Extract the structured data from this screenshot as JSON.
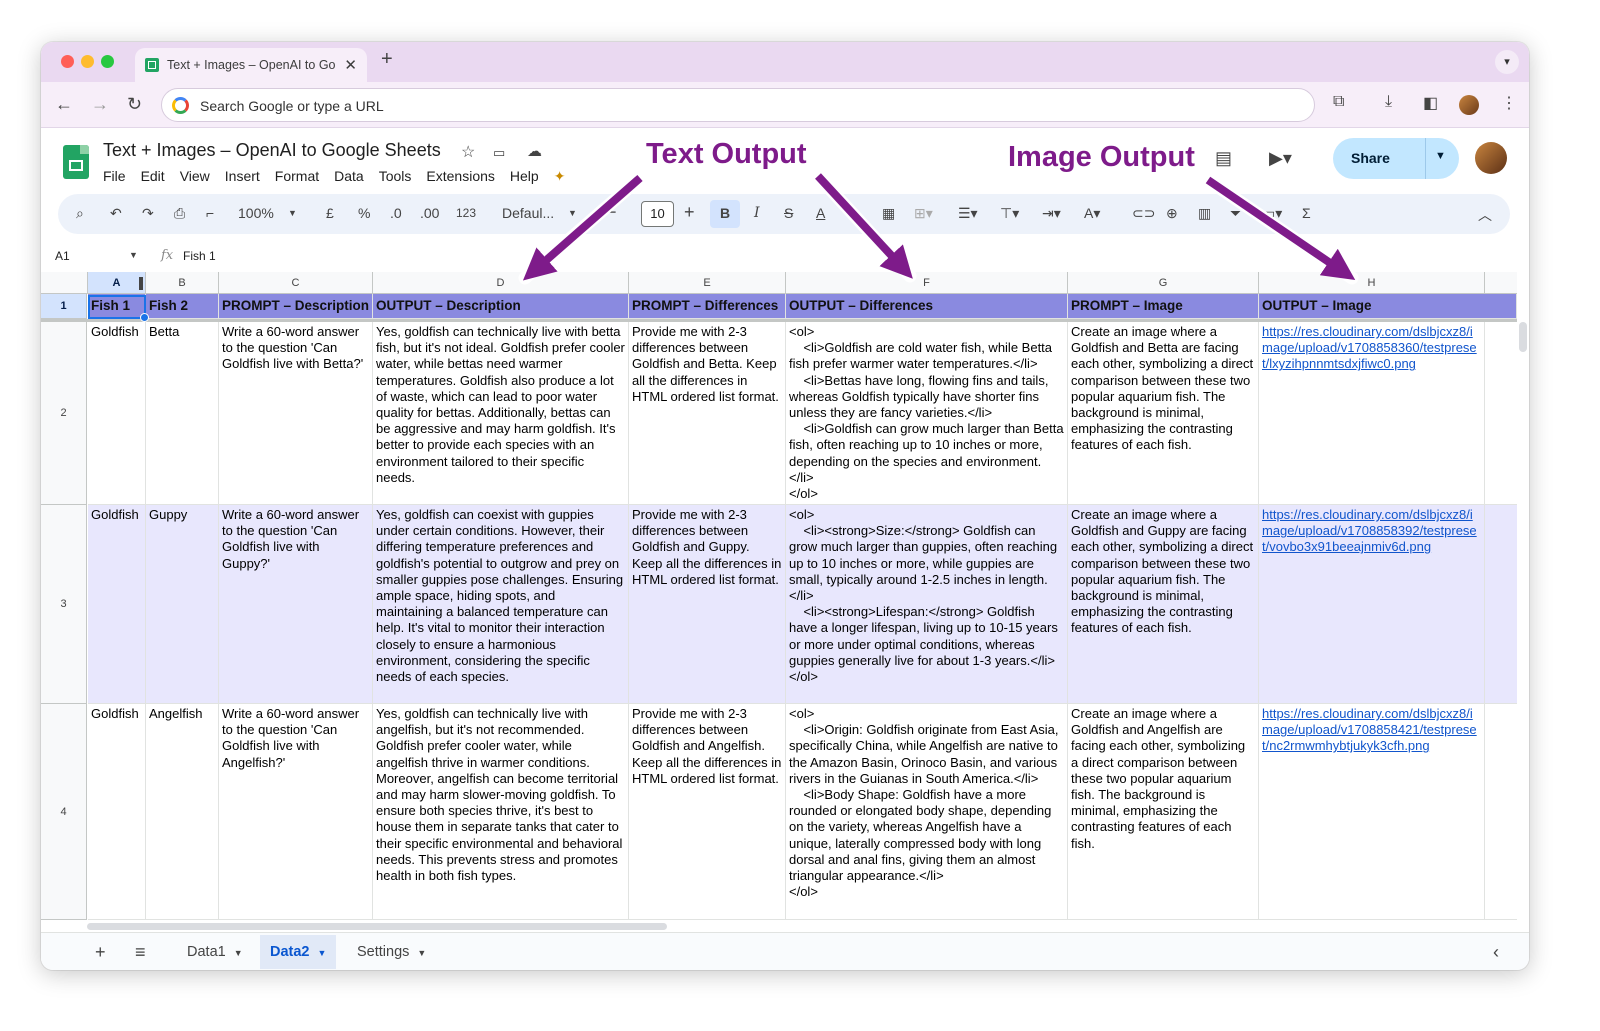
{
  "browser": {
    "tab_title": "Text + Images – OpenAI to Go",
    "omnibox_placeholder": "Search Google or type a URL"
  },
  "doc": {
    "title": "Text + Images – OpenAI to Google Sheets",
    "menu": [
      "File",
      "Edit",
      "View",
      "Insert",
      "Format",
      "Data",
      "Tools",
      "Extensions",
      "Help"
    ],
    "share_label": "Share"
  },
  "toolbar": {
    "zoom": "100%",
    "currency": "£",
    "percent": "%",
    "dec_decrease": ".0",
    "dec_increase": ".00",
    "number_format": "123",
    "font": "Defaul...",
    "font_size": "10",
    "bold": "B",
    "italic": "I",
    "sum": "Σ"
  },
  "formula_bar": {
    "cell_ref": "A1",
    "fx": "fx",
    "value": "Fish 1"
  },
  "annotations": {
    "text_output": "Text Output",
    "image_output": "Image Output"
  },
  "grid": {
    "columns": [
      "A",
      "B",
      "C",
      "D",
      "E",
      "F",
      "G",
      "H"
    ],
    "row_numbers": [
      "1",
      "2",
      "3",
      "4"
    ],
    "header": [
      "Fish 1",
      "Fish 2",
      "PROMPT – Description",
      "OUTPUT – Description",
      "PROMPT – Differences",
      "OUTPUT – Differences",
      "PROMPT – Image",
      "OUTPUT – Image"
    ],
    "rows": [
      [
        "Goldfish",
        "Betta",
        "Write a 60-word answer to the question 'Can Goldfish live with Betta?'",
        "Yes, goldfish can technically live with betta fish, but it's not ideal. Goldfish prefer cooler water, while bettas need warmer temperatures. Goldfish also produce a lot of waste, which can lead to poor water quality for bettas. Additionally, bettas can be aggressive and may harm goldfish. It's better to provide each species with an environment tailored to their specific needs.",
        "Provide me with 2-3 differences between Goldfish and Betta. Keep all the differences in HTML ordered list format.",
        "<ol>\n    <li>Goldfish are cold water fish, while Betta fish prefer warmer water temperatures.</li>\n    <li>Bettas have long, flowing fins and tails, whereas Goldfish typically have shorter fins unless they are fancy varieties.</li>\n    <li>Goldfish can grow much larger than Betta fish, often reaching up to 10 inches or more, depending on the species and environment.</li>\n</ol>",
        "Create an image where a Goldfish and Betta are facing each other, symbolizing a direct comparison between these two popular aquarium fish. The background is minimal, emphasizing the contrasting features of each fish.",
        "https://res.cloudinary.com/dslbjcxz8/image/upload/v1708858360/testpreset/lxyzihpnnmtsdxjfiwc0.png"
      ],
      [
        "Goldfish",
        "Guppy",
        "Write a 60-word answer to the question 'Can Goldfish live with Guppy?'",
        "Yes, goldfish can coexist with guppies under certain conditions. However, their differing temperature preferences and goldfish's potential to outgrow and prey on smaller guppies pose challenges. Ensuring ample space, hiding spots, and maintaining a balanced temperature can help. It's vital to monitor their interaction closely to ensure a harmonious environment, considering the specific needs of each species.",
        "Provide me with 2-3 differences between Goldfish and Guppy. Keep all the differences in HTML ordered list format.",
        "<ol>\n    <li><strong>Size:</strong> Goldfish can grow much larger than guppies, often reaching up to 10 inches or more, while guppies are small, typically around 1-2.5 inches in length.</li>\n    <li><strong>Lifespan:</strong> Goldfish have a longer lifespan, living up to 10-15 years or more under optimal conditions, whereas guppies generally live for about 1-3 years.</li>\n</ol>",
        "Create an image where a Goldfish and Guppy are facing each other, symbolizing a direct comparison between these two popular aquarium fish. The background is minimal, emphasizing the contrasting features of each fish.",
        "https://res.cloudinary.com/dslbjcxz8/image/upload/v1708858392/testpreset/vovbo3x91beeajnmiv6d.png"
      ],
      [
        "Goldfish",
        "Angelfish",
        "Write a 60-word answer to the question 'Can Goldfish live with Angelfish?'",
        "Yes, goldfish can technically live with angelfish, but it's not recommended. Goldfish prefer cooler water, while angelfish thrive in warmer conditions. Moreover, angelfish can become territorial and may harm slower-moving goldfish. To ensure both species thrive, it's best to house them in separate tanks that cater to their specific environmental and behavioral needs. This prevents stress and promotes health in both fish types.",
        "Provide me with 2-3 differences between Goldfish and Angelfish. Keep all the differences in HTML ordered list format.",
        "<ol>\n    <li>Origin: Goldfish originate from East Asia, specifically China, while Angelfish are native to the Amazon Basin, Orinoco Basin, and various rivers in the Guianas in South America.</li>\n    <li>Body Shape: Goldfish have a more rounded or elongated body shape, depending on the variety, whereas Angelfish have a unique, laterally compressed body with long dorsal and anal fins, giving them an almost triangular appearance.</li>\n</ol>",
        "Create an image where a Goldfish and Angelfish are facing each other, symbolizing a direct comparison between these two popular aquarium fish. The background is minimal, emphasizing the contrasting features of each fish.",
        "https://res.cloudinary.com/dslbjcxz8/image/upload/v1708858421/testpreset/nc2rmwmhybtjukyk3cfh.png"
      ]
    ]
  },
  "sheets": {
    "tabs": [
      "Data1",
      "Data2",
      "Settings"
    ],
    "active": "Data2"
  },
  "colors": {
    "header_fill": "#8a8ae0",
    "band_fill": "#e8e7fd",
    "annotation": "#7e1b8a",
    "share_bg": "#c2e7ff"
  }
}
